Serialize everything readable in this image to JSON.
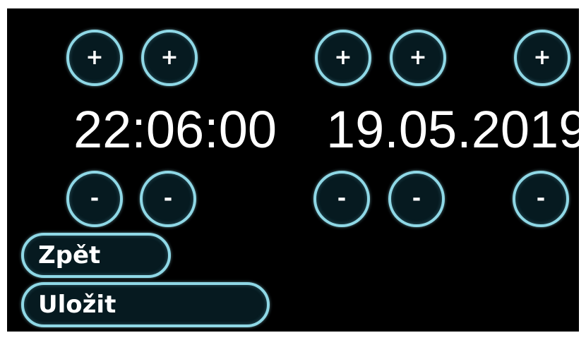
{
  "time": {
    "value": "22:06:00"
  },
  "date": {
    "value": "19.05.2019"
  },
  "controls": {
    "plus": "+",
    "minus": "-"
  },
  "actions": {
    "back_label": "Zpět",
    "save_label": "Uložit"
  },
  "colors": {
    "background": "#000000",
    "button_border": "#8fd8e6",
    "text": "#ffffff"
  }
}
